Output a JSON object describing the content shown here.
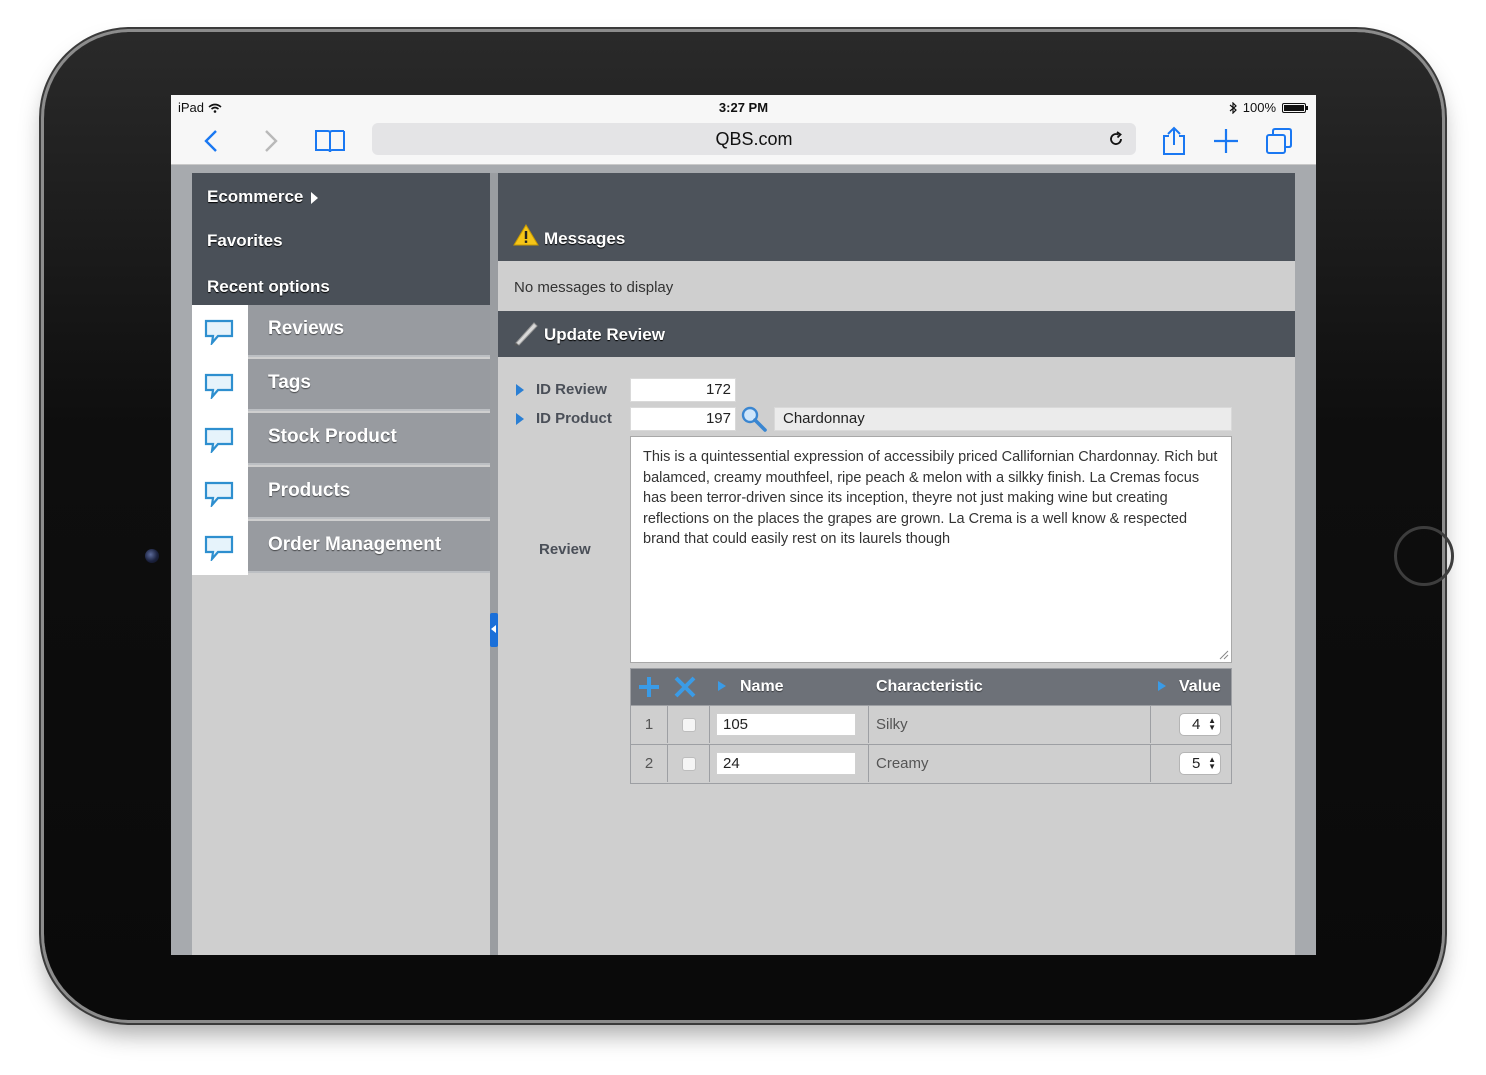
{
  "status_bar": {
    "device": "iPad",
    "time": "3:27 PM",
    "battery": "100%"
  },
  "browser": {
    "url": "QBS.com"
  },
  "top_menu": [
    {
      "label": "Ecommerce",
      "has_arrow": true
    },
    {
      "label": "Favorites"
    },
    {
      "label": "Recent options"
    }
  ],
  "nav": [
    {
      "label": "Reviews"
    },
    {
      "label": "Tags"
    },
    {
      "label": "Stock Product"
    },
    {
      "label": "Products"
    },
    {
      "label": "Order Management"
    }
  ],
  "messages": {
    "title": "Messages",
    "empty_text": "No messages to display"
  },
  "update_review": {
    "title": "Update Review",
    "id_review_label": "ID Review",
    "id_review_value": "172",
    "id_product_label": "ID Product",
    "id_product_value": "197",
    "product_name": "Chardonnay",
    "review_label": "Review",
    "review_text": "This is a quintessential expression of accessibily priced Callifornian Chardonnay. Rich but balamced, creamy mouthfeel, ripe peach & melon with a silkky finish. La Cremas focus has been terror-driven since its inception, theyre not just making wine but creating reflections on the places the grapes are grown. La Crema is a well know & respected brand that could easily rest on its laurels though"
  },
  "characteristics_grid": {
    "columns": [
      "Name",
      "Characteristic",
      "Value"
    ],
    "rows": [
      {
        "index": "1",
        "name": "105",
        "characteristic": "Silky",
        "value": "4"
      },
      {
        "index": "2",
        "name": "24",
        "characteristic": "Creamy",
        "value": "5"
      }
    ]
  },
  "colors": {
    "accent": "#1a78f2",
    "header_dark": "#4d535b",
    "nav_item": "#989ba0"
  }
}
